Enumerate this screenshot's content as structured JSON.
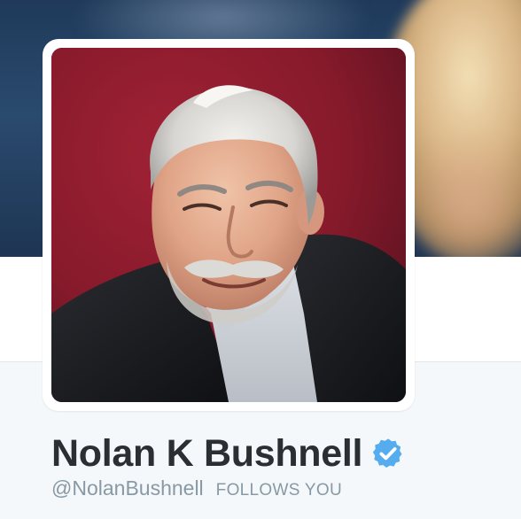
{
  "profile": {
    "name": "Nolan K Bushnell",
    "handle": "@NolanBushnell",
    "follows_you": "FOLLOWS YOU",
    "verified": true
  },
  "icons": {
    "verified": "verified-badge-icon"
  },
  "colors": {
    "verified_badge": "#55acee",
    "name_text": "#292f33",
    "muted_text": "#8899a6",
    "page_background": "#f5f8fa",
    "avatar_background": "#8a1a2a"
  }
}
